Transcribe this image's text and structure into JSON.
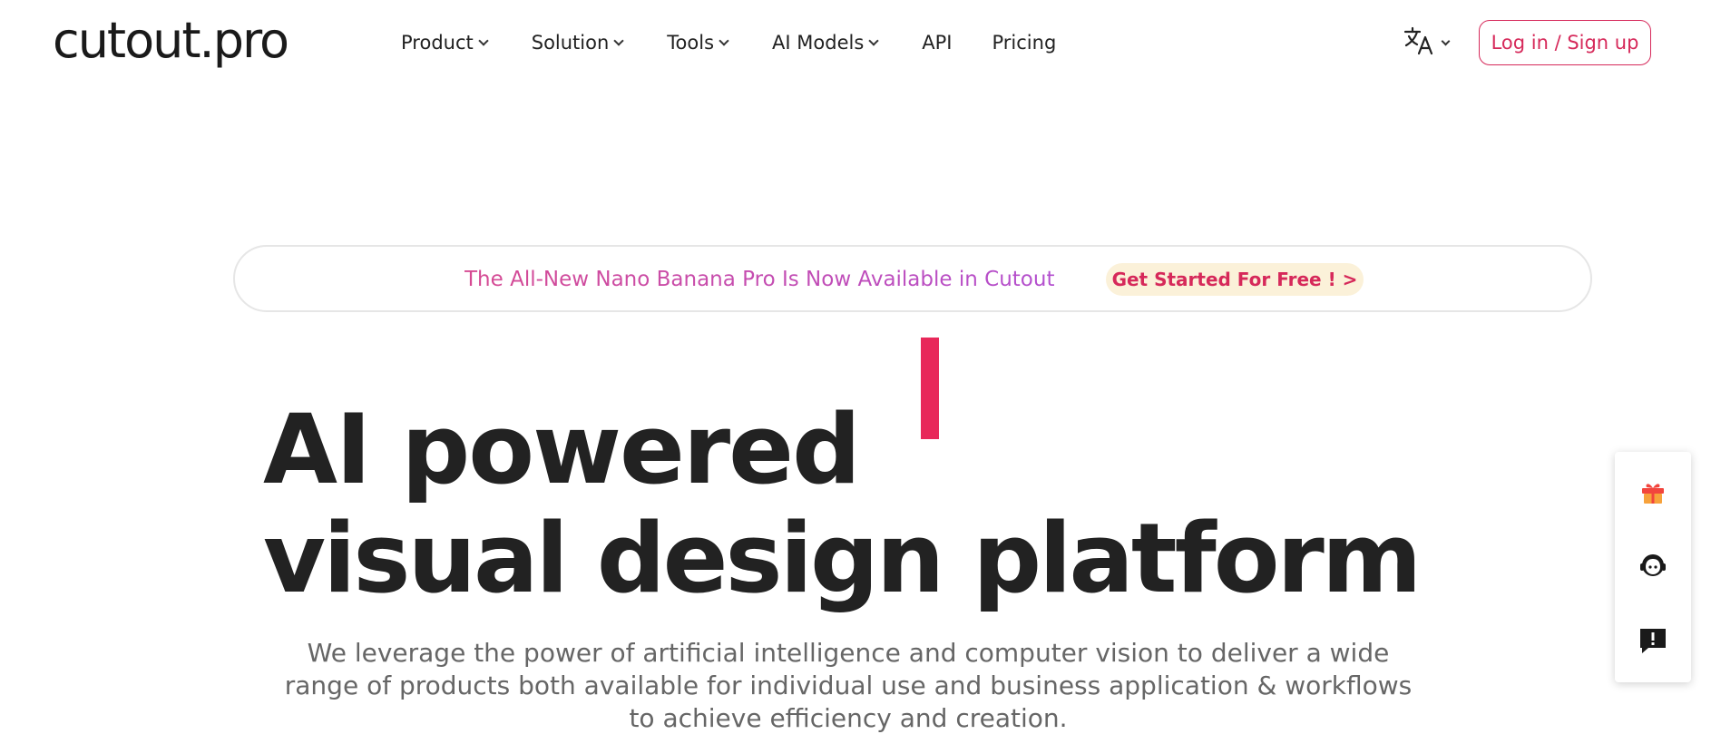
{
  "header": {
    "logo_text": "cutout.pro",
    "nav": [
      {
        "label": "Product",
        "has_dropdown": true
      },
      {
        "label": "Solution",
        "has_dropdown": true
      },
      {
        "label": "Tools",
        "has_dropdown": true
      },
      {
        "label": "AI Models",
        "has_dropdown": true
      },
      {
        "label": "API",
        "has_dropdown": false
      },
      {
        "label": "Pricing",
        "has_dropdown": false
      }
    ],
    "language_icon": "translate-icon",
    "login_label": "Log in / Sign up"
  },
  "banner": {
    "text": "The All-New Nano Banana Pro Is Now Available in Cutout",
    "cta_label": "Get Started For Free ! >"
  },
  "hero": {
    "line1": "AI powered",
    "line2": "visual design platform",
    "description": "We leverage the power of artificial intelligence and computer vision to deliver a wide range of products both available for individual use and business application & workflows to achieve efficiency and creation."
  },
  "side_panel": {
    "items": [
      {
        "icon": "gift-icon"
      },
      {
        "icon": "support-agent-icon"
      },
      {
        "icon": "feedback-icon"
      }
    ]
  },
  "colors": {
    "accent": "#e8285a",
    "login_border": "#d6295a",
    "banner_gradient_start": "#d64a92",
    "banner_gradient_end": "#b34fcf",
    "cta_background": "#fbf1d9",
    "heading": "#222222",
    "description": "#666666"
  }
}
